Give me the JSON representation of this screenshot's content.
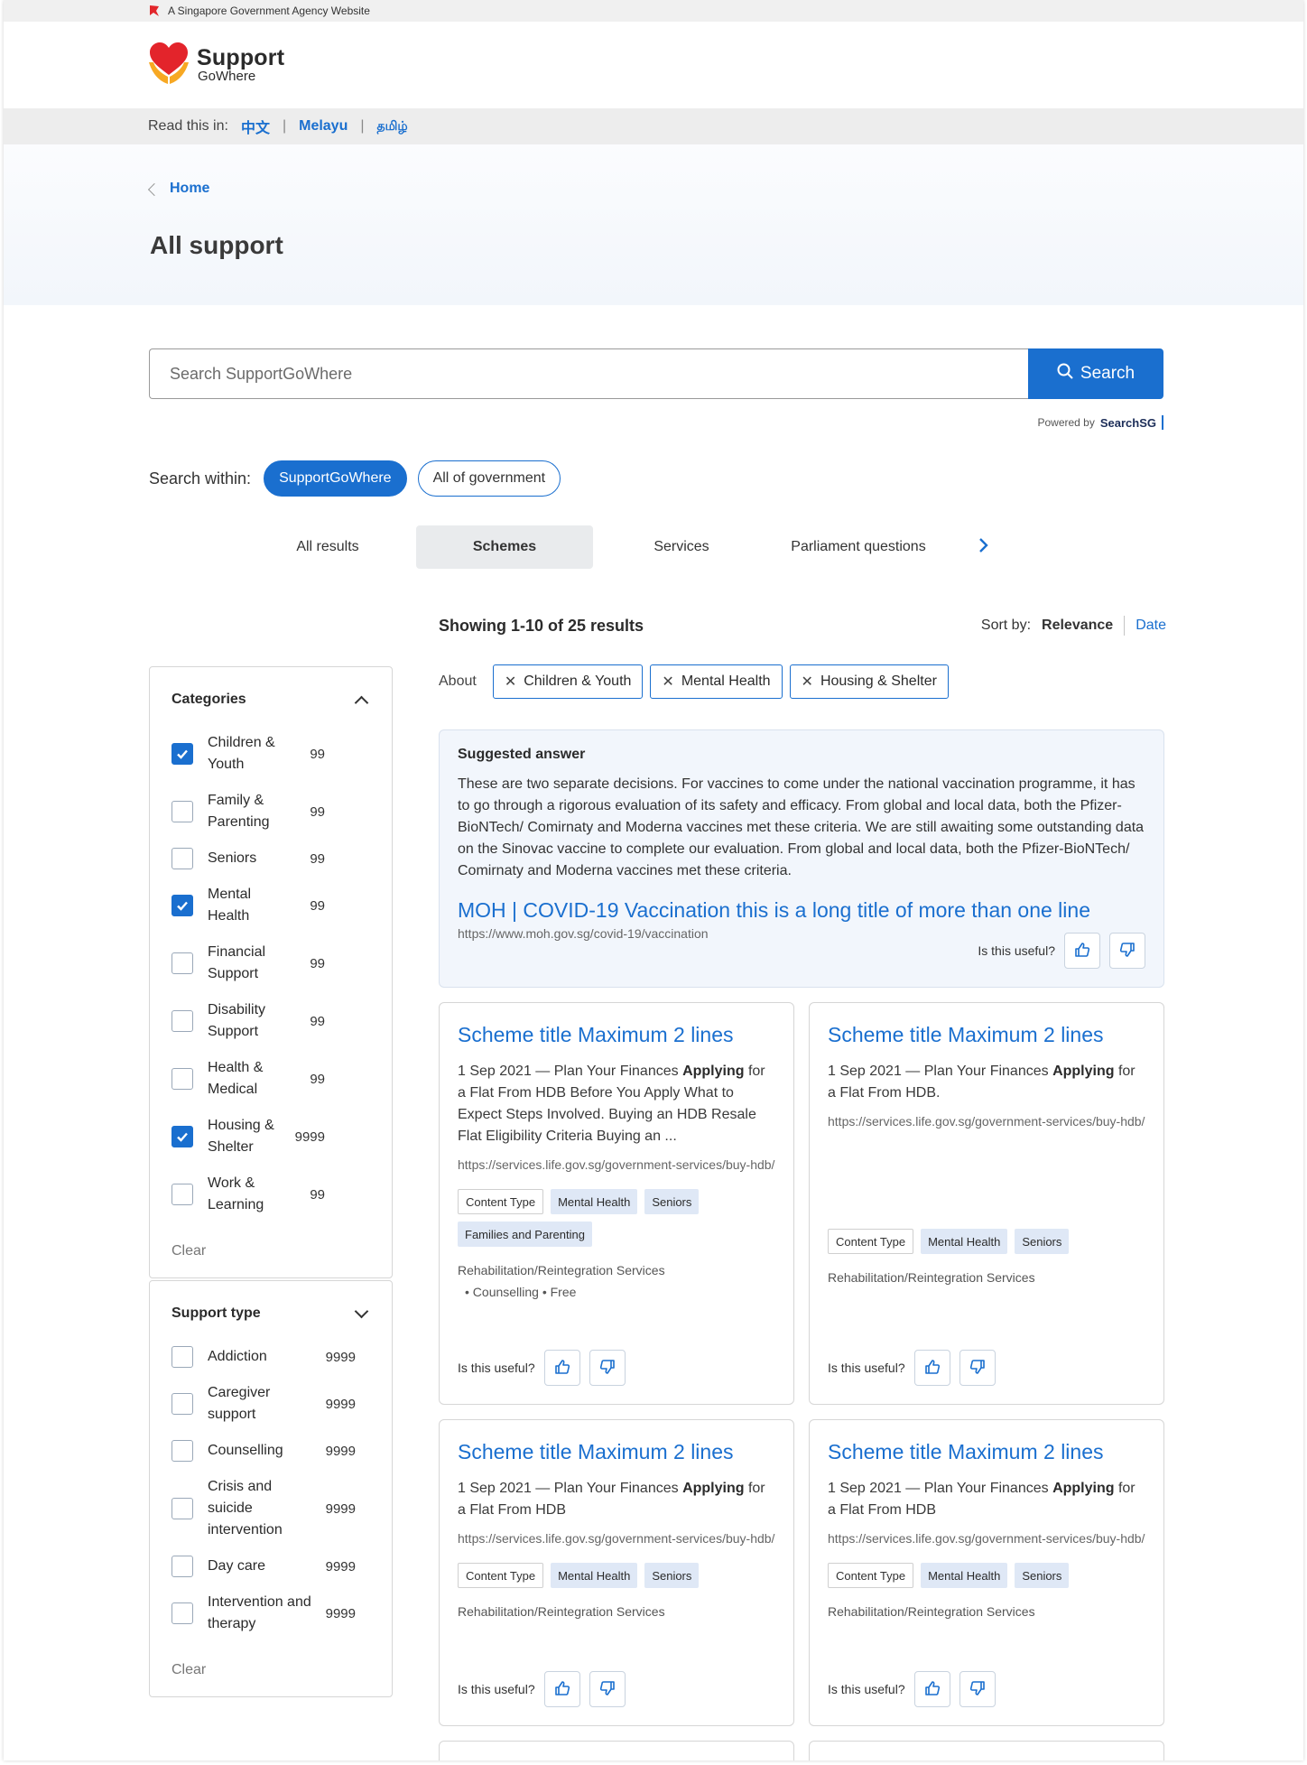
{
  "masthead": {
    "text": "A Singapore Government Agency Website"
  },
  "logo": {
    "line1": "Support",
    "line2": "GoWhere"
  },
  "lang": {
    "prefix": "Read this in:",
    "options": [
      "中文",
      "Melayu",
      "தமிழ்"
    ]
  },
  "breadcrumb": {
    "home": "Home"
  },
  "page_title": "All support",
  "search": {
    "placeholder": "Search SupportGoWhere",
    "button": "Search",
    "powered_prefix": "Powered by",
    "powered_brand": "SearchSG"
  },
  "within": {
    "label": "Search within:",
    "options": [
      "SupportGoWhere",
      "All of government"
    ],
    "selected": "SupportGoWhere"
  },
  "tabs": {
    "items": [
      "All results",
      "Schemes",
      "Services",
      "Parliament questions"
    ],
    "active": "Schemes"
  },
  "results": {
    "showing": "Showing 1-10 of 25 results",
    "sort_label": "Sort by:",
    "sort_relevance": "Relevance",
    "sort_date": "Date"
  },
  "about": {
    "label": "About",
    "chips": [
      "Children & Youth",
      "Mental Health",
      "Housing & Shelter"
    ]
  },
  "categories": {
    "title": "Categories",
    "items": [
      {
        "label": "Children & Youth",
        "count": "99",
        "checked": true
      },
      {
        "label": "Family & Parenting",
        "count": "99",
        "checked": false
      },
      {
        "label": "Seniors",
        "count": "99",
        "checked": false
      },
      {
        "label": "Mental Health",
        "count": "99",
        "checked": true
      },
      {
        "label": "Financial Support",
        "count": "99",
        "checked": false
      },
      {
        "label": "Disability Support",
        "count": "99",
        "checked": false
      },
      {
        "label": "Health & Medical",
        "count": "99",
        "checked": false
      },
      {
        "label": "Housing & Shelter",
        "count": "9999",
        "checked": true
      },
      {
        "label": "Work & Learning",
        "count": "99",
        "checked": false
      }
    ],
    "clear": "Clear"
  },
  "support_type": {
    "title": "Support type",
    "items": [
      {
        "label": "Addiction",
        "count": "9999",
        "checked": false
      },
      {
        "label": "Caregiver support",
        "count": "9999",
        "checked": false
      },
      {
        "label": "Counselling",
        "count": "9999",
        "checked": false
      },
      {
        "label": "Crisis and suicide intervention",
        "count": "9999",
        "checked": false
      },
      {
        "label": "Day care",
        "count": "9999",
        "checked": false
      },
      {
        "label": "Intervention and therapy",
        "count": "9999",
        "checked": false
      }
    ],
    "clear": "Clear"
  },
  "suggested": {
    "title": "Suggested answer",
    "body": "These are two separate decisions. For vaccines to come under the national vaccination programme, it has to go through a rigorous evaluation of its safety and efficacy. From global and local data, both the Pfizer-BioNTech/ Comirnaty and Moderna vaccines met these criteria. We are still awaiting some outstanding data on the Sinovac vaccine to complete our evaluation. From global and local data, both the Pfizer-BioNTech/ Comirnaty and Moderna vaccines met these criteria.",
    "link": "MOH | COVID-19 Vaccination this is a long title of more than one line",
    "url": "https://www.moh.gov.sg/covid-19/vaccination",
    "useful": "Is this useful?"
  },
  "cards": [
    {
      "title": "Scheme title Maximum 2 lines",
      "date": "1 Sep 2021 — Plan Your Finances ",
      "bold": "Applying",
      "rest": " for a Flat From HDB Before You Apply What to Expect Steps Involved. Buying an HDB Resale Flat Eligibility Criteria Buying an ...",
      "url": "https://services.life.gov.sg/government-services/buy-hdb/",
      "tags": [
        "Content Type",
        "Mental Health",
        "Seniors",
        "Families and Parenting"
      ],
      "category": "Rehabilitation/Reintegration Services",
      "sub": "• Counselling • Free",
      "useful": "Is this useful?"
    },
    {
      "title": "Scheme title Maximum 2 lines",
      "date": "1 Sep 2021 — Plan Your Finances ",
      "bold": "Applying",
      "rest": " for a Flat From HDB.",
      "url": "https://services.life.gov.sg/government-services/buy-hdb/",
      "tags": [
        "Content Type",
        "Mental Health",
        "Seniors"
      ],
      "category": "Rehabilitation/Reintegration Services",
      "sub": "",
      "useful": "Is this useful?"
    },
    {
      "title": "Scheme title Maximum 2 lines",
      "date": "1 Sep 2021 — Plan Your Finances ",
      "bold": "Applying",
      "rest": " for a Flat From HDB",
      "url": "https://services.life.gov.sg/government-services/buy-hdb/",
      "tags": [
        "Content Type",
        "Mental Health",
        "Seniors"
      ],
      "category": "Rehabilitation/Reintegration Services",
      "sub": "",
      "useful": "Is this useful?"
    },
    {
      "title": "Scheme title Maximum 2 lines",
      "date": "1 Sep 2021 — Plan Your Finances ",
      "bold": "Applying",
      "rest": " for a Flat From HDB",
      "url": "https://services.life.gov.sg/government-services/buy-hdb/",
      "tags": [
        "Content Type",
        "Mental Health",
        "Seniors"
      ],
      "category": "Rehabilitation/Reintegration Services",
      "sub": "",
      "useful": "Is this useful?"
    }
  ],
  "colors": {
    "primary": "#1a6fcf",
    "tag_blue": "#dfe8f6",
    "suggest_bg": "#f2f6fc",
    "lang_bar": "#ededed"
  }
}
